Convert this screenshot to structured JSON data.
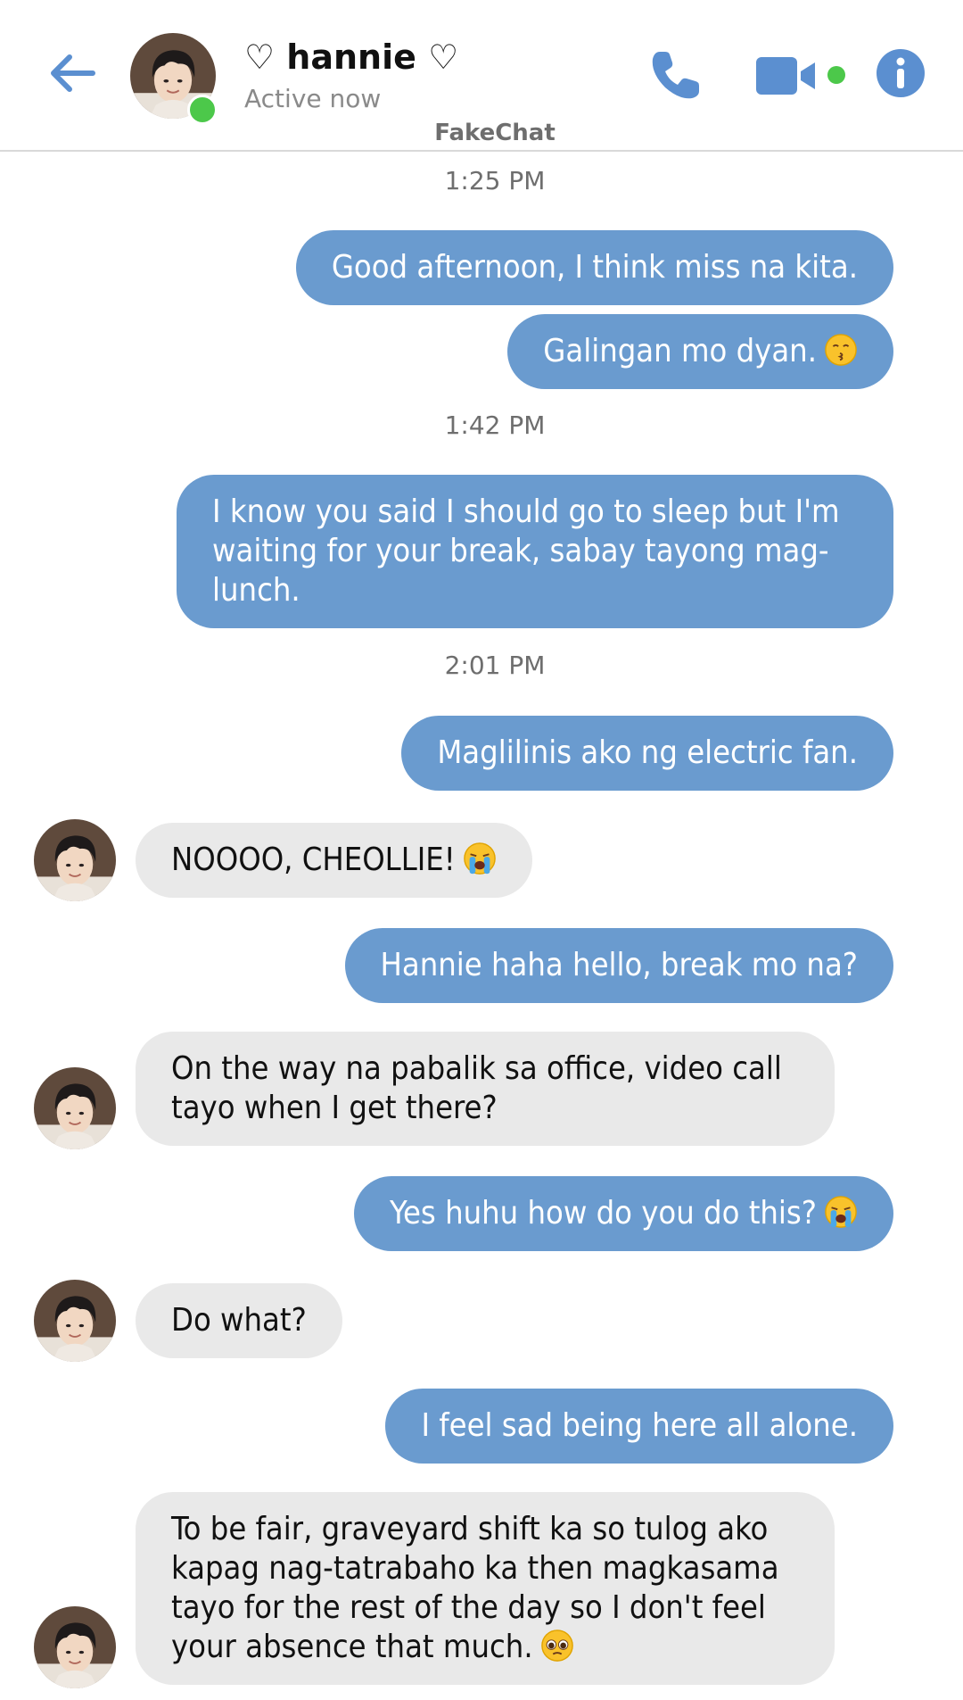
{
  "header": {
    "contact_name": "♡ hannie ♡",
    "status": "Active now",
    "app_name": "FakeChat"
  },
  "colors": {
    "accent": "#5b8fd0",
    "outgoing_bubble": "#6a9bcf",
    "incoming_bubble": "#e9e9e9",
    "online": "#4cc84a"
  },
  "timestamps": [
    "1:25 PM",
    "1:42 PM",
    "2:01 PM"
  ],
  "messages": [
    {
      "from": "me",
      "text": "Good afternoon, I think miss na kita."
    },
    {
      "from": "me",
      "text": "Galingan mo dyan.",
      "emoji": "kissing-face"
    },
    {
      "from": "me",
      "text": "I know you said I should go to sleep but I'm waiting for your break, sabay tayong mag-lunch."
    },
    {
      "from": "me",
      "text": "Maglilinis ako ng electric fan."
    },
    {
      "from": "them",
      "text": "NOOOO, CHEOLLIE!",
      "emoji": "loudly-crying-face"
    },
    {
      "from": "me",
      "text": "Hannie haha hello, break mo na?"
    },
    {
      "from": "them",
      "text": "On the way na pabalik sa office, video call tayo when I get there?"
    },
    {
      "from": "me",
      "text": "Yes huhu how do you do this?",
      "emoji": "loudly-crying-face"
    },
    {
      "from": "them",
      "text": "Do what?"
    },
    {
      "from": "me",
      "text": "I feel sad being here all alone."
    },
    {
      "from": "them",
      "text": "To be fair, graveyard shift ka so tulog ako kapag nag-tatrabaho ka then magkasama tayo for the rest of the day so I don't feel your absence that much.",
      "emoji": "pleading-face"
    }
  ]
}
